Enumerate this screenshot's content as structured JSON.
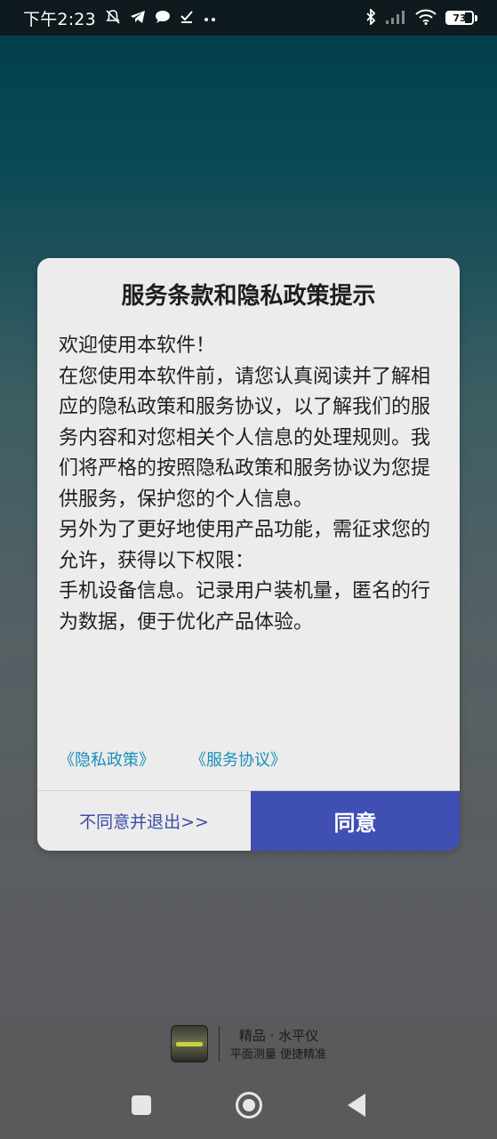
{
  "status_bar": {
    "time": "下午2:23",
    "battery": "73",
    "battery_fraction": 0.73,
    "icons": [
      "mute-bell-icon",
      "telegram-icon",
      "chat-bubble-icon",
      "checkmark-icon",
      "more-dots-icon",
      "bluetooth-icon",
      "signal-icon",
      "wifi-icon",
      "battery-icon"
    ]
  },
  "dialog": {
    "title": "服务条款和隐私政策提示",
    "body": "欢迎使用本软件！\n在您使用本软件前，请您认真阅读并了解相应的隐私政策和服务协议，以了解我们的服务内容和对您相关个人信息的处理规则。我们将严格的按照隐私政策和服务协议为您提供服务，保护您的个人信息。\n另外为了更好地使用产品功能，需征求您的允许，获得以下权限：\n手机设备信息。记录用户装机量，匿名的行为数据，便于优化产品体验。",
    "privacy_link": "《隐私政策》",
    "service_link": "《服务协议》",
    "disagree_button": "不同意并退出>>",
    "agree_button": "同意"
  },
  "banner": {
    "app_name": "精品 · 水平仪",
    "slogan": "平面测量  便捷精准"
  },
  "colors": {
    "accent": "#3f4fb4",
    "link": "#1a8fb8",
    "dialog_bg": "#ececec"
  }
}
